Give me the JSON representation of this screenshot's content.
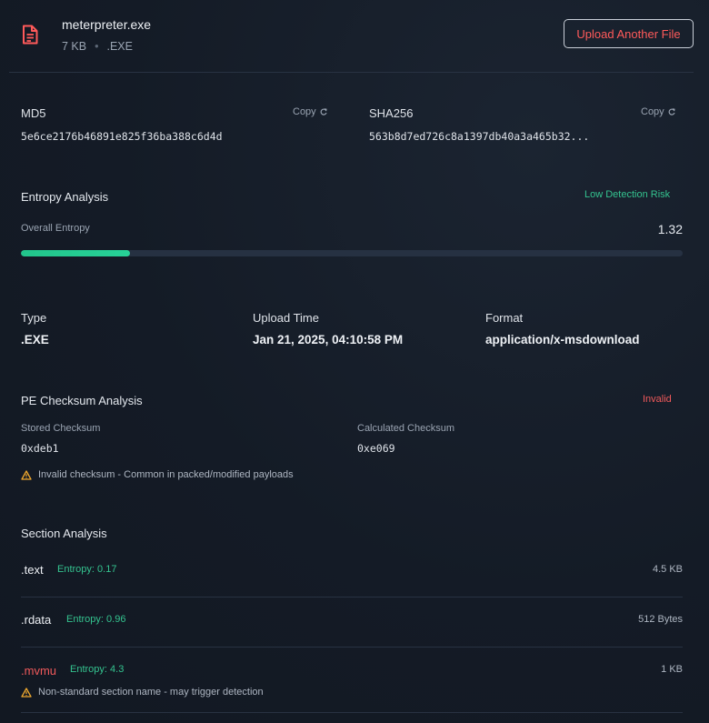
{
  "file": {
    "name": "meterpreter.exe",
    "size": "7 KB",
    "separator": "•",
    "ext": ".EXE",
    "upload_button": "Upload Another File"
  },
  "hashes": {
    "md5": {
      "label": "MD5",
      "value": "5e6ce2176b46891e825f36ba388c6d4d",
      "copy": "Copy"
    },
    "sha256": {
      "label": "SHA256",
      "value": "563b8d7ed726c8a1397db40a3a465b32...",
      "copy": "Copy"
    }
  },
  "entropy": {
    "title": "Entropy Analysis",
    "risk": "Low Detection Risk",
    "label": "Overall Entropy",
    "value": "1.32",
    "fill_fraction": 0.165
  },
  "info": {
    "type": {
      "label": "Type",
      "value": ".EXE"
    },
    "upload_time": {
      "label": "Upload Time",
      "value": "Jan 21, 2025, 04:10:58 PM"
    },
    "format": {
      "label": "Format",
      "value": "application/x-msdownload"
    }
  },
  "checksum": {
    "title": "PE Checksum Analysis",
    "status": "Invalid",
    "stored_label": "Stored Checksum",
    "stored_value": "0xdeb1",
    "calculated_label": "Calculated Checksum",
    "calculated_value": "0xe069",
    "warning": "Invalid checksum - Common in packed/modified payloads"
  },
  "sections": {
    "title": "Section Analysis",
    "items": [
      {
        "name": ".text",
        "entropy": "Entropy: 0.17",
        "size": "4.5 KB"
      },
      {
        "name": ".rdata",
        "entropy": "Entropy: 0.96",
        "size": "512 Bytes"
      },
      {
        "name": ".mvmu",
        "entropy": "Entropy: 4.3",
        "size": "1 KB",
        "warning": "Non-standard section name - may trigger detection"
      }
    ]
  },
  "colors": {
    "accent_green": "#34c38f",
    "danger_red": "#f0595b",
    "warning_amber": "#f0a92e"
  }
}
